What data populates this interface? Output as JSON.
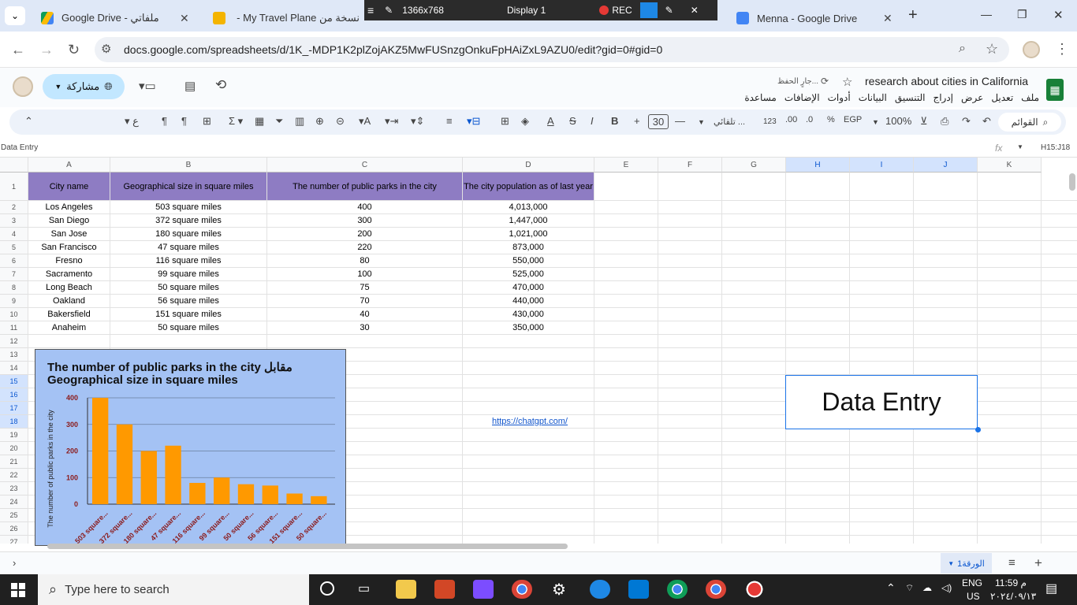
{
  "browser": {
    "tabs": [
      {
        "title": "Google Drive - ملفاتي"
      },
      {
        "title": "نسخة من My Travel Plane - ال..."
      },
      {
        "title": "Menna - Google Drive"
      }
    ],
    "new_tab": "+",
    "recorder": {
      "resolution": "1366x768",
      "display": "Display 1",
      "rec": "REC"
    },
    "url": "docs.google.com/spreadsheets/d/1K_-MDP1K2plZojAKZ5MwFUSnzgOnkuFpHAiZxL9AZU0/edit?gid=0#gid=0"
  },
  "doc": {
    "title": "research about cities in California",
    "saving": "جارٍ الحفظ...",
    "share": "مشاركة",
    "menus": [
      "ملف",
      "تعديل",
      "عرض",
      "إدراج",
      "التنسيق",
      "البيانات",
      "أدوات",
      "الإضافات",
      "مساعدة"
    ]
  },
  "toolbar": {
    "menus_search": "القوائم",
    "zoom": "100%",
    "currency": "EGP",
    "percent": "%",
    "decimal_dec": ".0",
    "decimal_inc": ".00",
    "number_format": "123",
    "font": "تلقائي ...",
    "font_size": "30"
  },
  "formula_bar": {
    "name_box": "Data Entry",
    "range": "H15:J18",
    "fx": "fx"
  },
  "columns": [
    "A",
    "B",
    "C",
    "D",
    "E",
    "F",
    "G",
    "H",
    "I",
    "J",
    "K"
  ],
  "rows": [
    "1",
    "2",
    "3",
    "4",
    "5",
    "6",
    "7",
    "8",
    "9",
    "10",
    "11",
    "12",
    "13",
    "14",
    "15",
    "16",
    "17",
    "18",
    "19",
    "20",
    "21",
    "22",
    "23",
    "24",
    "25",
    "26",
    "27"
  ],
  "table": {
    "headers": [
      "City name",
      "Geographical size in square miles",
      "The number of public parks in the city",
      "The city population as of last year"
    ],
    "rows": [
      [
        "Los Angeles",
        "503 square miles",
        "400",
        "4,013,000"
      ],
      [
        "San Diego",
        "372 square miles",
        "300",
        "1,447,000"
      ],
      [
        "San Jose",
        "180 square miles",
        "200",
        "1,021,000"
      ],
      [
        "San Francisco",
        "47 square miles",
        "220",
        "873,000"
      ],
      [
        "Fresno",
        "116 square miles",
        "80",
        "550,000"
      ],
      [
        "Sacramento",
        "99 square miles",
        "100",
        "525,000"
      ],
      [
        "Long Beach",
        "50 square miles",
        "75",
        "470,000"
      ],
      [
        "Oakland",
        "56 square miles",
        "70",
        "440,000"
      ],
      [
        "Bakersfield",
        "151 square miles",
        "40",
        "430,000"
      ],
      [
        "Anaheim",
        "50 square miles",
        "30",
        "350,000"
      ]
    ]
  },
  "link": "https://chatgpt.com/",
  "data_entry_label": "Data Entry",
  "chart_data": {
    "type": "bar",
    "title": "The number of public parks in the city مقابل Geographical size in square miles",
    "title_line1": "The number of public parks in the city مقابل",
    "title_line2": "Geographical size in square miles",
    "ylabel": "The number of public parks in the city",
    "categories": [
      "503 square...",
      "372 square...",
      "180 square...",
      "47 square...",
      "116 square...",
      "99 square...",
      "50 square...",
      "56 square...",
      "151 square...",
      "50 square..."
    ],
    "values": [
      400,
      300,
      200,
      220,
      80,
      100,
      75,
      70,
      40,
      30
    ],
    "ylim": [
      0,
      400
    ],
    "yticks": [
      "0",
      "100",
      "200",
      "300",
      "400"
    ],
    "bar_color": "#ff9900",
    "background": "#a4c2f4"
  },
  "sheet_tab": "الورقة1",
  "taskbar": {
    "search_placeholder": "Type here to search",
    "lang1": "ENG",
    "lang2": "US",
    "time": "11:59 م",
    "date": "٢٠٢٤/٠٩/١٣"
  }
}
